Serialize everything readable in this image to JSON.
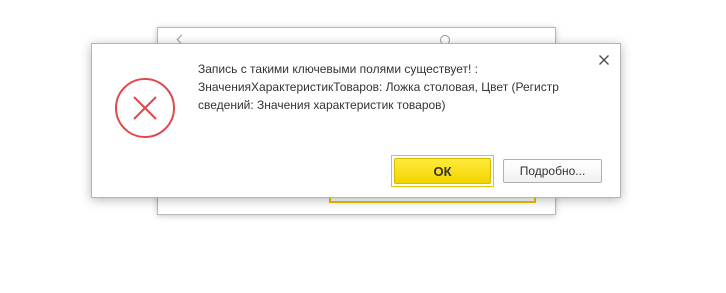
{
  "dialog": {
    "message": "Запись с такими ключевыми полями существует! :\nЗначенияХарактеристикТоваров: Ложка столовая, Цвет (Регистр\nсведений: Значения характеристик товаров)",
    "ok_label": "ОК",
    "details_label": "Подробно...",
    "icon": "error-x-icon",
    "close_icon": "close-icon"
  },
  "colors": {
    "error_red": "#e2494b",
    "ok_yellow": "#f5d800",
    "frame_yellow": "#f0c000",
    "text": "#333333"
  }
}
